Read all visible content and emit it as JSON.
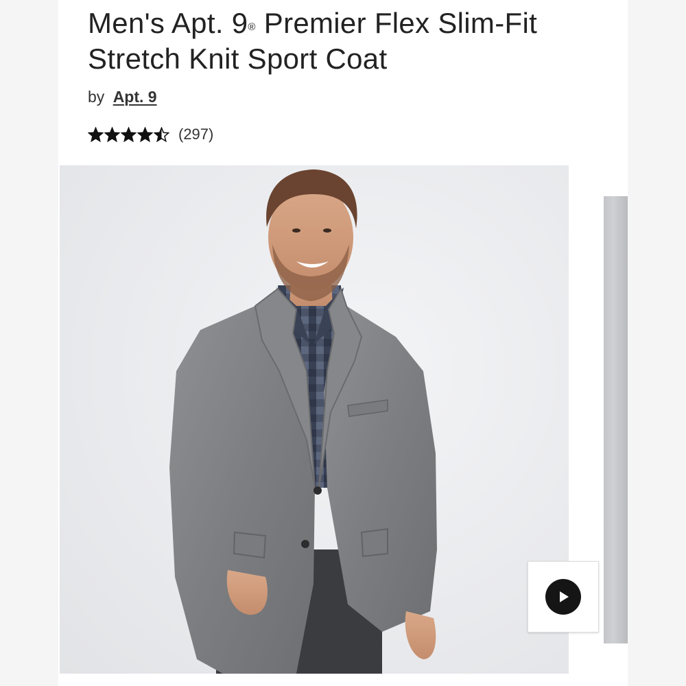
{
  "product": {
    "title_part1": "Men's Apt. 9",
    "title_registered": "®",
    "title_part2": " Premier Flex Slim-Fit Stretch Knit Sport Coat",
    "by_label": "by",
    "brand": "Apt. 9",
    "rating": 4.5,
    "max_rating": 5,
    "review_count": "(297)"
  },
  "media": {
    "main_image_alt": "Men's Apt. 9 Premier Flex Slim-Fit Stretch Knit Sport Coat",
    "video_icon": "play-icon"
  },
  "colors": {
    "text": "#222222",
    "star": "#111111",
    "play_button": "#151515"
  }
}
